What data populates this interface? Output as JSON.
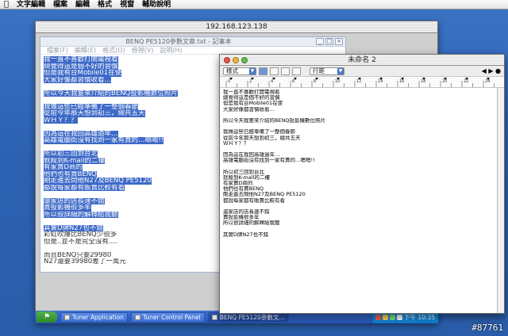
{
  "menubar": {
    "apple_icon": "apple-icon",
    "items": [
      "文字編輯",
      "檔案",
      "編輯",
      "格式",
      "視窗",
      "輔助說明"
    ]
  },
  "remote": {
    "title": "192.168.123.138"
  },
  "notepad": {
    "title": "BENQ PE5120參數文章.txt - 記事本",
    "menu": [
      "檔案(F)",
      "編輯(E)",
      "格式(O)",
      "檢視(V)",
      "說明(H)"
    ],
    "selected_lines": [
      "我一直不喜歡打開電視看",
      "總覺得這是個不好的習慣",
      "但是我有台Mobile01在使",
      "大家好像都習慣收看…",
      "",
      "所以今天我要來介紹的BENQ投影機數位照片",
      "",
      "我做這些已經準備了一整個春節",
      "從前今年那天想到初三，總共五天",
      "ＷＨＹ？？",
      "",
      "因為這在我回高雄過年…",
      "高雄電腦街沒有找到一家有賣的…嗯嗯!!",
      "",
      "所以初三回到台北",
      "就殺到K-mall的二樓",
      "有家賣D商的",
      "他們也有賣BENQ",
      "剛走進去問他N27及BENQ PE5120",
      "都說每家都有販賣比較有看",
      "",
      "還家店的店長速不錯",
      "賣投影機很多年",
      "所以很詳細的解釋給我聽",
      "",
      "其實D牌N27也不錯"
    ],
    "unselected_lines": [
      "彩虹吹爆比BENQ少很多",
      "但是..並不是完全沒有....",
      "",
      "而且BENQ只要29980",
      "N27還要39980差了一萬元"
    ]
  },
  "textedit": {
    "title": "未命名 2",
    "style_select": "樣式",
    "spacing_select": "行距",
    "ruler_labels": [
      "0",
      "2",
      "4",
      "6",
      "8",
      "10",
      "12",
      "14",
      "16",
      "18",
      "20",
      "22",
      "24"
    ],
    "lines": [
      "我一直不喜歡打開電視看",
      "總覺得這是個不好的習慣",
      "但是我有台Mobile01在使",
      "大家好像都習慣收看…",
      "",
      "所以今天我要來介紹的BENQ投影機數位照片",
      "",
      "我做這些已經準備了一整個春節",
      "從前今年那天想到初三，總共五天",
      "ＷＨＹ？？",
      "",
      "因為這在我回高雄過年…",
      "高雄電腦街沒有找到一家有賣的…嗯嗯!!",
      "",
      "所以初三回到台北",
      "就殺到K-mall的二樓",
      "有家賣D商的",
      "他們也有賣BENQ",
      "剛走進去問他N27及BENQ PE5120",
      "都說每家都有販賣比較有看",
      "",
      "還家店的店長速不錯",
      "賣投影機很多年",
      "所以很詳細的解釋給我聽",
      "",
      "其實D牌N27也不錯"
    ]
  },
  "taskbar": {
    "start_label": "",
    "tasks": [
      "Tuner Application",
      "Tuner Control Panel",
      "BENQ PE5120參數文..."
    ],
    "clock": "下午 10:35"
  },
  "watermark": "#87761",
  "colors": {
    "selection": "#3d69c7",
    "desktop": "#2f64b4",
    "taskbar": "#2f5fc4"
  }
}
